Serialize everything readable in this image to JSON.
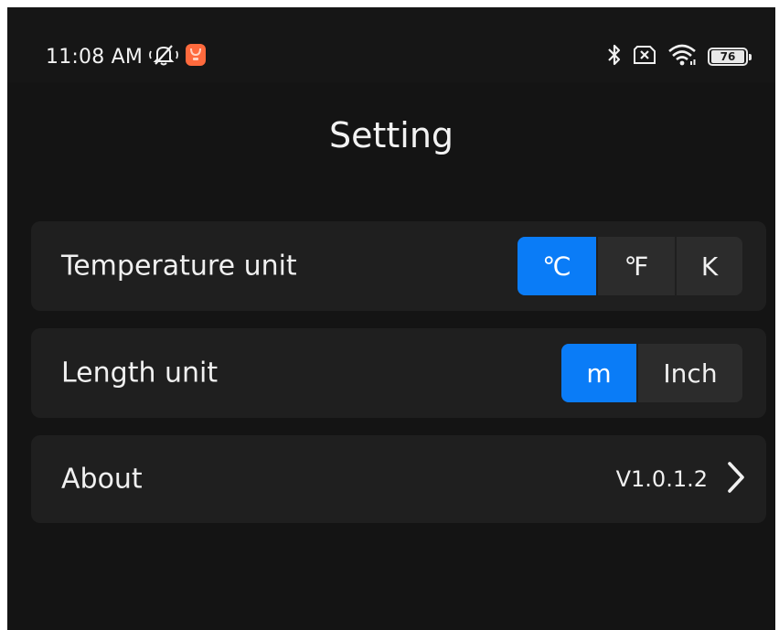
{
  "status_bar": {
    "time": "11:08 AM",
    "battery_level": "76",
    "icons": [
      "mute-icon",
      "app-notification-icon",
      "bluetooth-icon",
      "sim-off-icon",
      "wifi-icon",
      "battery-icon"
    ]
  },
  "page": {
    "title": "Setting"
  },
  "settings": {
    "temperature": {
      "label": "Temperature unit",
      "options": [
        "℃",
        "℉",
        "K"
      ],
      "selected": "℃"
    },
    "length": {
      "label": "Length unit",
      "options": [
        "m",
        "Inch"
      ],
      "selected": "m"
    },
    "about": {
      "label": "About",
      "version": "V1.0.1.2"
    }
  },
  "colors": {
    "accent": "#0a7cf7",
    "background": "#141414",
    "card": "#1f1f1f",
    "app_icon": "#ff6a3d"
  }
}
